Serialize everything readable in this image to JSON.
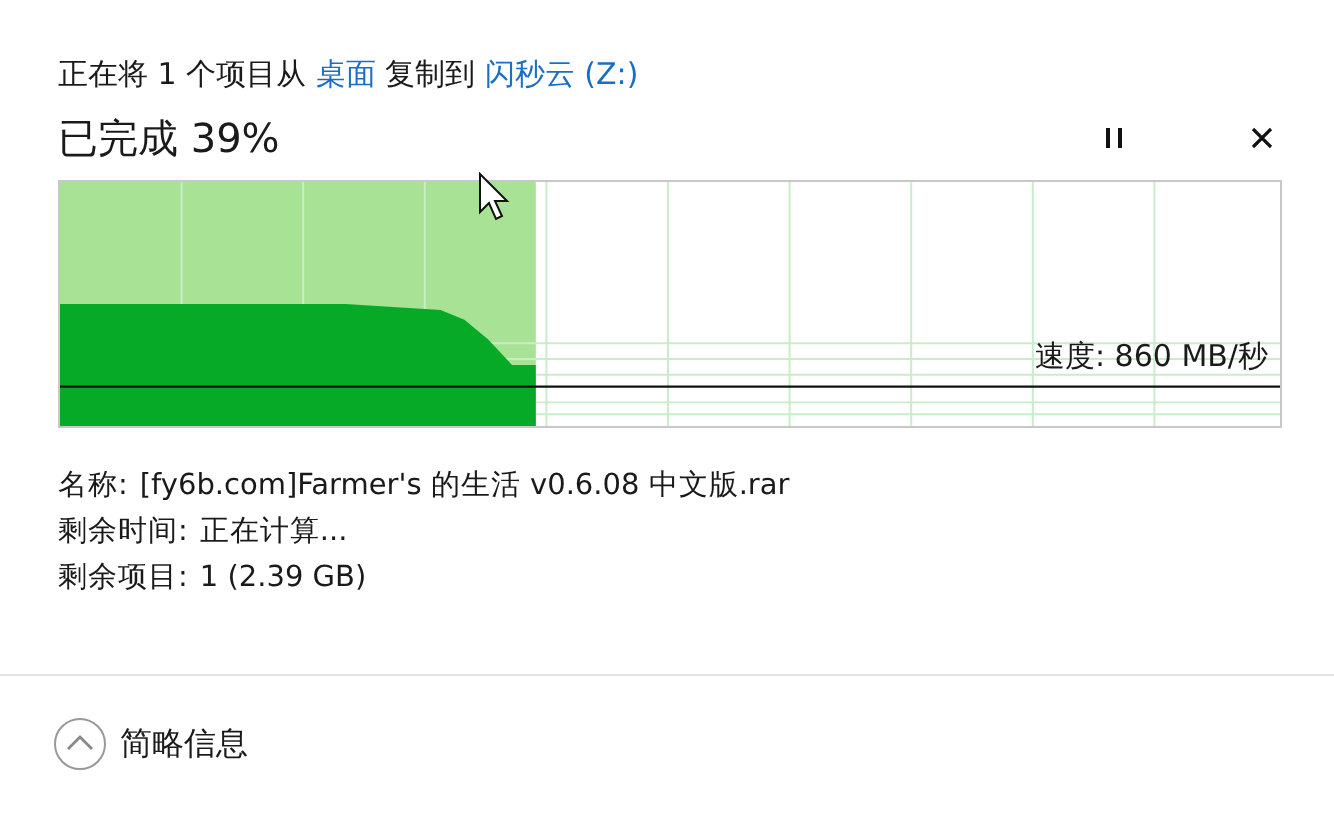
{
  "header": {
    "parts": [
      {
        "kind": "text",
        "text": "正在将 1 个项目从 "
      },
      {
        "kind": "link",
        "text": "桌面"
      },
      {
        "kind": "text",
        "text": " 复制到 "
      },
      {
        "kind": "link",
        "text": "闪秒云 (Z:)"
      }
    ]
  },
  "progress": {
    "title": "已完成 39%",
    "level": 0.39,
    "speed": "速度: 860 MB/秒"
  },
  "details": [
    {
      "label": "名称:",
      "value": "[fy6b.com]Farmer's 的生活 v0.6.08 中文版.rar"
    },
    {
      "label": "剩余时间:",
      "value": "正在计算..."
    },
    {
      "label": "剩余项目:",
      "value": "1 (2.39 GB)"
    }
  ],
  "footer": {
    "label": "简略信息",
    "expanded": true
  }
}
